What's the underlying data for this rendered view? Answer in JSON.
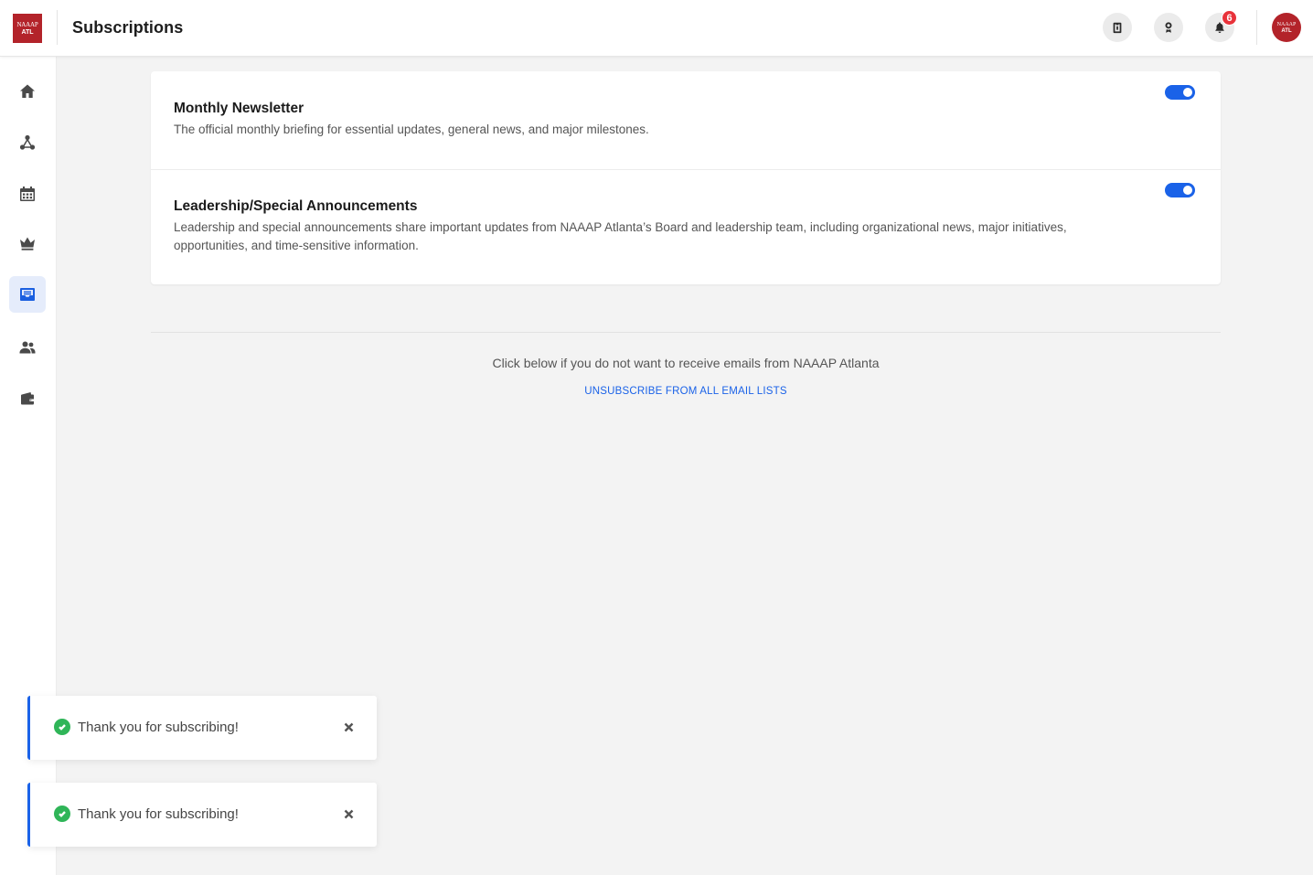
{
  "app": {
    "logo_line1": "NAAAP",
    "logo_line2": "ATL",
    "page_title": "Subscriptions"
  },
  "header": {
    "icons": [
      "badge-id-icon",
      "certificate-icon",
      "bell-icon"
    ],
    "notification_count": "6",
    "avatar_line1": "NAAAP",
    "avatar_line2": "ATL"
  },
  "sidebar": {
    "items": [
      {
        "icon": "home-icon",
        "active": false
      },
      {
        "icon": "network-icon",
        "active": false
      },
      {
        "icon": "calendar-icon",
        "active": false
      },
      {
        "icon": "crown-icon",
        "active": false
      },
      {
        "icon": "inbox-icon",
        "active": true
      },
      {
        "icon": "users-icon",
        "active": false
      },
      {
        "icon": "wallet-icon",
        "active": false
      }
    ]
  },
  "subscriptions": [
    {
      "title": "Monthly Newsletter",
      "description": "The official monthly briefing for essential updates, general news, and major milestones.",
      "enabled": true
    },
    {
      "title": "Leadership/Special Announcements",
      "description": "Leadership and special announcements share important updates from NAAAP Atlanta’s Board and leadership team, including organizational news, major initiatives, opportunities, and time-sensitive information.",
      "enabled": true
    }
  ],
  "unsubscribe": {
    "prompt": "Click below if you do not want to receive emails from NAAAP Atlanta",
    "link_label": "UNSUBSCRIBE FROM ALL EMAIL LISTS"
  },
  "toasts": [
    {
      "message": "Thank you for subscribing!"
    },
    {
      "message": "Thank you for subscribing!"
    }
  ],
  "colors": {
    "accent": "#1a62e8",
    "brand": "#b3232a",
    "success": "#2fb558",
    "badge": "#e8323a"
  }
}
